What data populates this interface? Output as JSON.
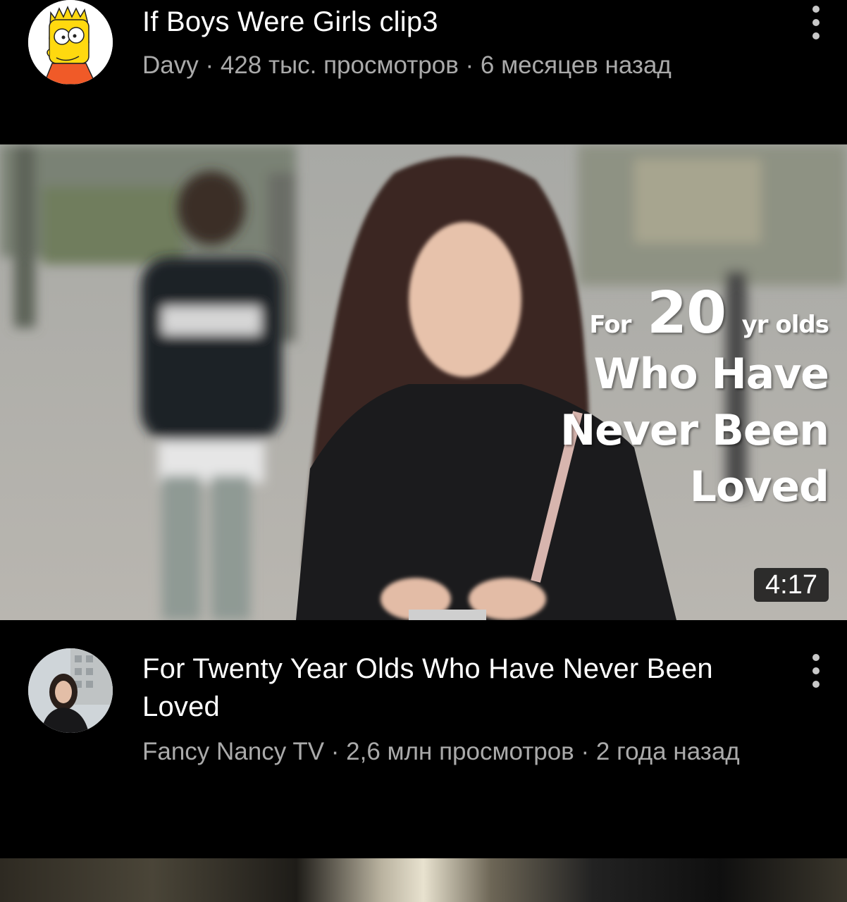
{
  "video1": {
    "title": "If Boys Were Girls clip3",
    "subtitle": "Davy · 428 тыс. просмотров · 6 месяцев назад",
    "avatar_icon": "bart-simpson-avatar",
    "menu_icon": "more-vertical-icon"
  },
  "video2": {
    "thumbnail": {
      "overlay_line1_for": "For",
      "overlay_line1_num": "20",
      "overlay_line1_yr": "yr olds",
      "overlay_line2": "Who Have",
      "overlay_line3": "Never Been",
      "overlay_line4": "Loved",
      "duration": "4:17"
    },
    "title": "For Twenty Year Olds Who Have Never Been Loved",
    "subtitle": "Fancy Nancy TV · 2,6 млн просмотров · 2 года назад",
    "avatar_icon": "channel-avatar-photo",
    "menu_icon": "more-vertical-icon"
  },
  "colors": {
    "background": "#000000",
    "title": "#ffffff",
    "subtitle": "#aaaaaa",
    "duration_badge": "#141414"
  }
}
